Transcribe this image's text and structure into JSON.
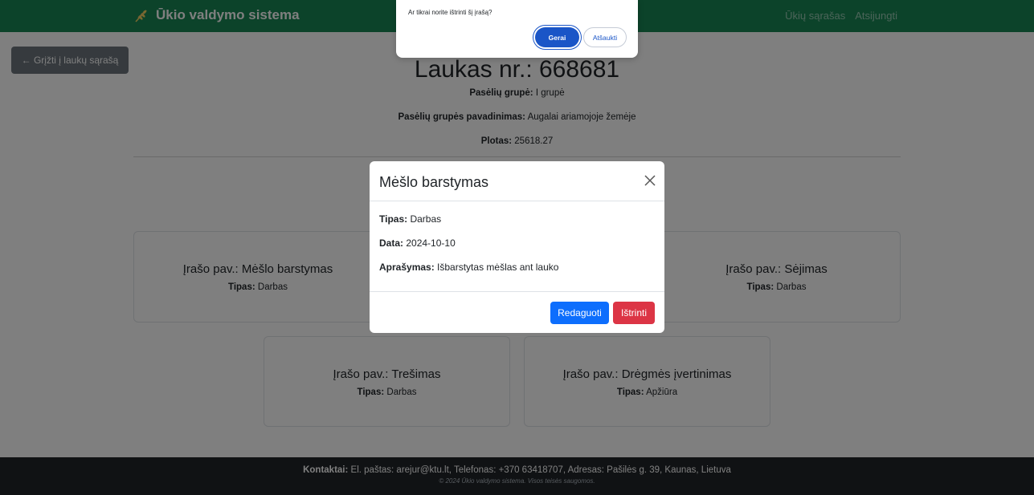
{
  "navbar": {
    "brand": "Ūkio valdymo sistema",
    "links": [
      "Ūkių sąrašas",
      "Atsijungti"
    ]
  },
  "back_button": "← Grįžti į laukų sąrašą",
  "field": {
    "title": "Laukas nr.: 668681",
    "group_label": "Pasėlių grupė:",
    "group_value": "I grupė",
    "group_name_label": "Pasėlių grupės pavadinimas:",
    "group_name_value": "Augalai ariamojoje žemėje",
    "area_label": "Plotas:",
    "area_value": "25618.27"
  },
  "records": [
    {
      "name_label": "Įrašo pav.:",
      "name": "Mėšlo barstymas",
      "type_label": "Tipas:",
      "type": "Darbas"
    },
    {
      "name_label": "Įrašo pav.:",
      "name": "Sėjimas",
      "type_label": "Tipas:",
      "type": "Darbas"
    },
    {
      "name_label": "Įrašo pav.:",
      "name": "Trešimas",
      "type_label": "Tipas:",
      "type": "Darbas"
    },
    {
      "name_label": "Įrašo pav.:",
      "name": "Drėgmės įvertinimas",
      "type_label": "Tipas:",
      "type": "Apžiūra"
    }
  ],
  "modal": {
    "title": "Mėšlo barstymas",
    "type_label": "Tipas:",
    "type_value": "Darbas",
    "date_label": "Data:",
    "date_value": "2024-10-10",
    "desc_label": "Aprašymas:",
    "desc_value": "Išbarstytas mėšlas ant lauko",
    "edit_button": "Redaguoti",
    "delete_button": "Ištrinti"
  },
  "confirm": {
    "message": "Ar tikrai norite ištrinti šį įrašą?",
    "ok_button": "Gerai",
    "cancel_button": "Atšaukti"
  },
  "footer": {
    "contacts_label": "Kontaktai:",
    "contacts_text": "El. paštas: arejur@ktu.lt, Telefonas: +370 63418707, Adresas: Pašilės g. 39, Kaunas, Lietuva",
    "copyright": "© 2024 Ūkio valdymo sistema. Visos teisės saugomos."
  },
  "colors": {
    "navbar": "#198754",
    "back_button": "#6c757d",
    "primary": "#0d6efd",
    "danger": "#dc3545",
    "footer": "#212529"
  }
}
